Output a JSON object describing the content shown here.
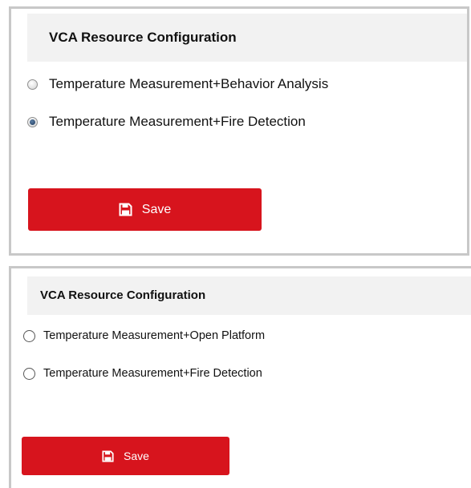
{
  "panels": [
    {
      "title": "VCA Resource Configuration",
      "options": [
        {
          "label": "Temperature Measurement+Behavior Analysis",
          "checked": false
        },
        {
          "label": "Temperature Measurement+Fire Detection",
          "checked": true
        }
      ],
      "save_label": "Save",
      "save_icon": "floppy-disk-icon"
    },
    {
      "title": "VCA Resource Configuration",
      "options": [
        {
          "label": "Temperature Measurement+Open Platform",
          "checked": false
        },
        {
          "label": "Temperature Measurement+Fire Detection",
          "checked": false
        }
      ],
      "save_label": "Save",
      "save_icon": "floppy-disk-icon"
    }
  ],
  "colors": {
    "accent": "#d7141d",
    "header_bg": "#f2f2f2",
    "border": "#c8c8c8"
  }
}
